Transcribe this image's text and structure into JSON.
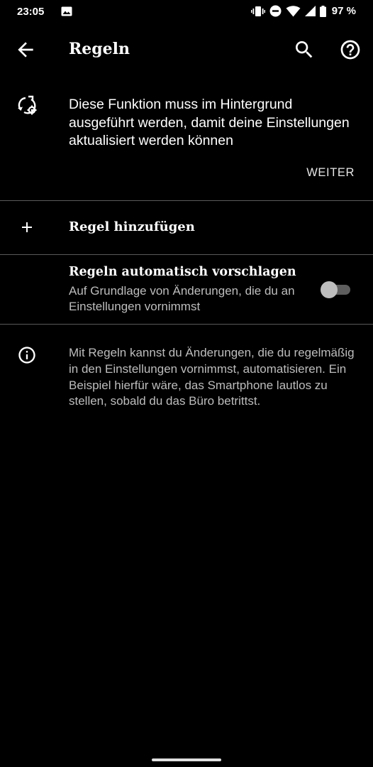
{
  "status_bar": {
    "time": "23:05",
    "battery_text": "97 %"
  },
  "toolbar": {
    "title": "Regeln",
    "icons": [
      "arrow-back-icon",
      "search-icon",
      "help-icon"
    ]
  },
  "banner": {
    "text": "Diese Funktion muss im Hintergrund ausgeführt werden, damit deine Einstellungen aktualisiert werden können",
    "button_label": "WEITER",
    "icon": "sync-settings-icon"
  },
  "add_rule": {
    "label": "Regel hinzufügen",
    "icon": "plus-icon"
  },
  "suggest_rules": {
    "title": "Regeln automatisch vorschlagen",
    "subtitle": "Auf Grundlage von Änderungen, die du an Einstellungen vornimmst",
    "enabled": false
  },
  "info": {
    "text": "Mit Regeln kannst du Änderungen, die du regelmäßig in den Einstellungen vornimmst, automatisieren. Ein Beispiel hierfür wäre, das Smartphone lautlos zu stellen, sobald du das Büro betrittst.",
    "icon": "info-icon"
  },
  "colors": {
    "background": "#000000",
    "text_primary": "#ffffff",
    "text_secondary": "#bdbdbd",
    "divider": "#5a5a5a",
    "toggle_off_track": "#5e5e5e",
    "toggle_off_thumb": "#bdbdbd"
  }
}
